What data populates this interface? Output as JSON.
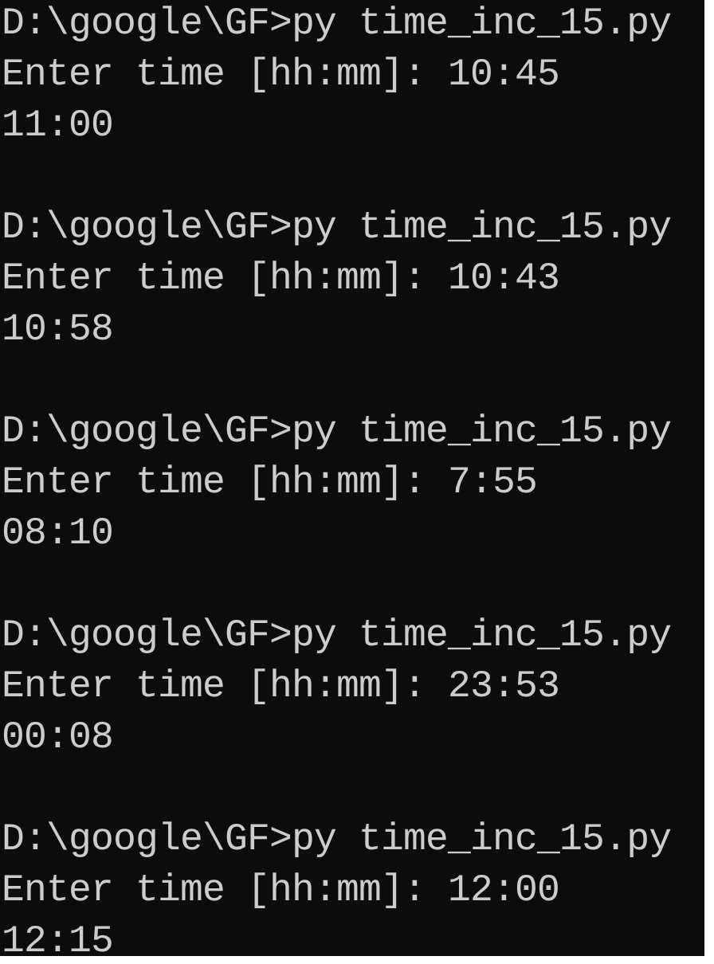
{
  "console": {
    "runs": [
      {
        "command_line": "D:\\google\\GF>py time_inc_15.py",
        "input_line": "Enter time [hh:mm]: 10:45",
        "output": "11:00"
      },
      {
        "command_line": "D:\\google\\GF>py time_inc_15.py",
        "input_line": "Enter time [hh:mm]: 10:43",
        "output": "10:58"
      },
      {
        "command_line": "D:\\google\\GF>py time_inc_15.py",
        "input_line": "Enter time [hh:mm]: 7:55",
        "output": "08:10"
      },
      {
        "command_line": "D:\\google\\GF>py time_inc_15.py",
        "input_line": "Enter time [hh:mm]: 23:53",
        "output": "00:08"
      },
      {
        "command_line": "D:\\google\\GF>py time_inc_15.py",
        "input_line": "Enter time [hh:mm]: 12:00",
        "output": "12:15"
      }
    ]
  }
}
